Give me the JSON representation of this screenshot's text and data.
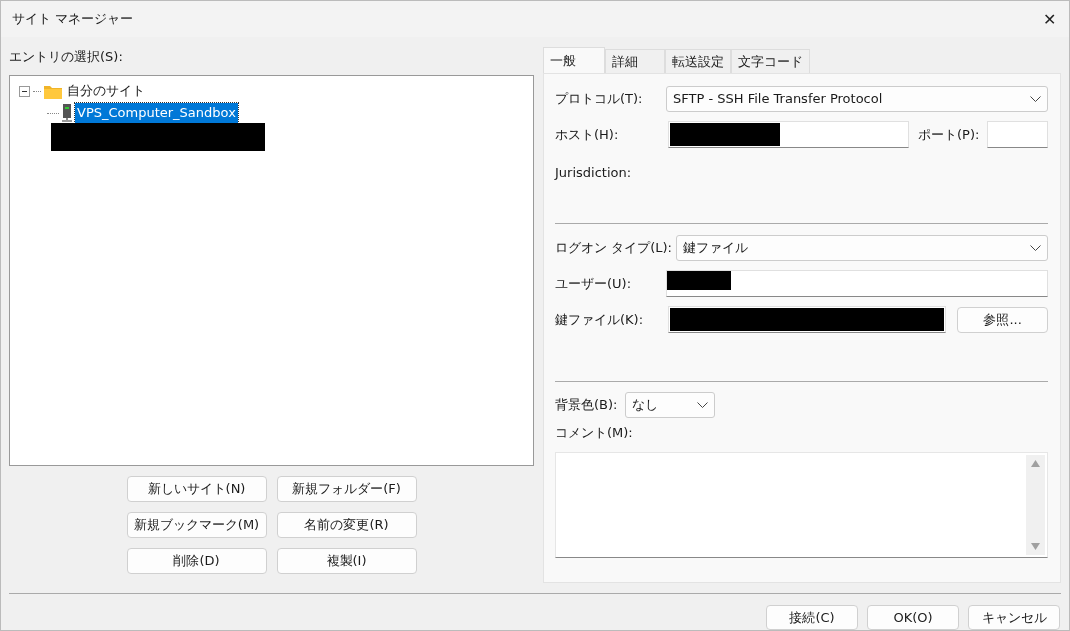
{
  "window": {
    "title": "サイト マネージャー",
    "close": "✕"
  },
  "entries": {
    "label": "エントリの選択(S):",
    "tree": [
      {
        "label": "自分のサイト",
        "kind": "folder",
        "expanded": true,
        "selected": false,
        "children": [
          {
            "label": "VPS_Computer_Sandbox",
            "kind": "server",
            "selected": true
          },
          {
            "kind": "redacted",
            "selected": false
          }
        ]
      }
    ]
  },
  "entry_buttons": [
    "新しいサイト(N)",
    "新規フォルダー(F)",
    "新規ブックマーク(M)",
    "名前の変更(R)",
    "削除(D)",
    "複製(I)"
  ],
  "tabs": [
    {
      "label": "一般",
      "selected": true
    },
    {
      "label": "詳細",
      "selected": false
    },
    {
      "label": "転送設定",
      "selected": false
    },
    {
      "label": "文字コード",
      "selected": false
    }
  ],
  "general": {
    "protocol": {
      "label": "プロトコル(T):",
      "value": "SFTP - SSH File Transfer Protocol"
    },
    "host": {
      "label": "ホスト(H):",
      "redacted": true
    },
    "port": {
      "label": "ポート(P):"
    },
    "jurisdiction": {
      "label": "Jurisdiction:"
    },
    "logon_type": {
      "label": "ログオン タイプ(L):",
      "value": "鍵ファイル"
    },
    "user": {
      "label": "ユーザー(U):",
      "redacted": true
    },
    "key_file": {
      "label": "鍵ファイル(K):",
      "redacted": true,
      "browse": "参照..."
    },
    "background_color": {
      "label": "背景色(B):",
      "value": "なし"
    },
    "comment": {
      "label": "コメント(M):"
    }
  },
  "dialog_buttons": [
    "接続(C)",
    "OK(O)",
    "キャンセル"
  ]
}
